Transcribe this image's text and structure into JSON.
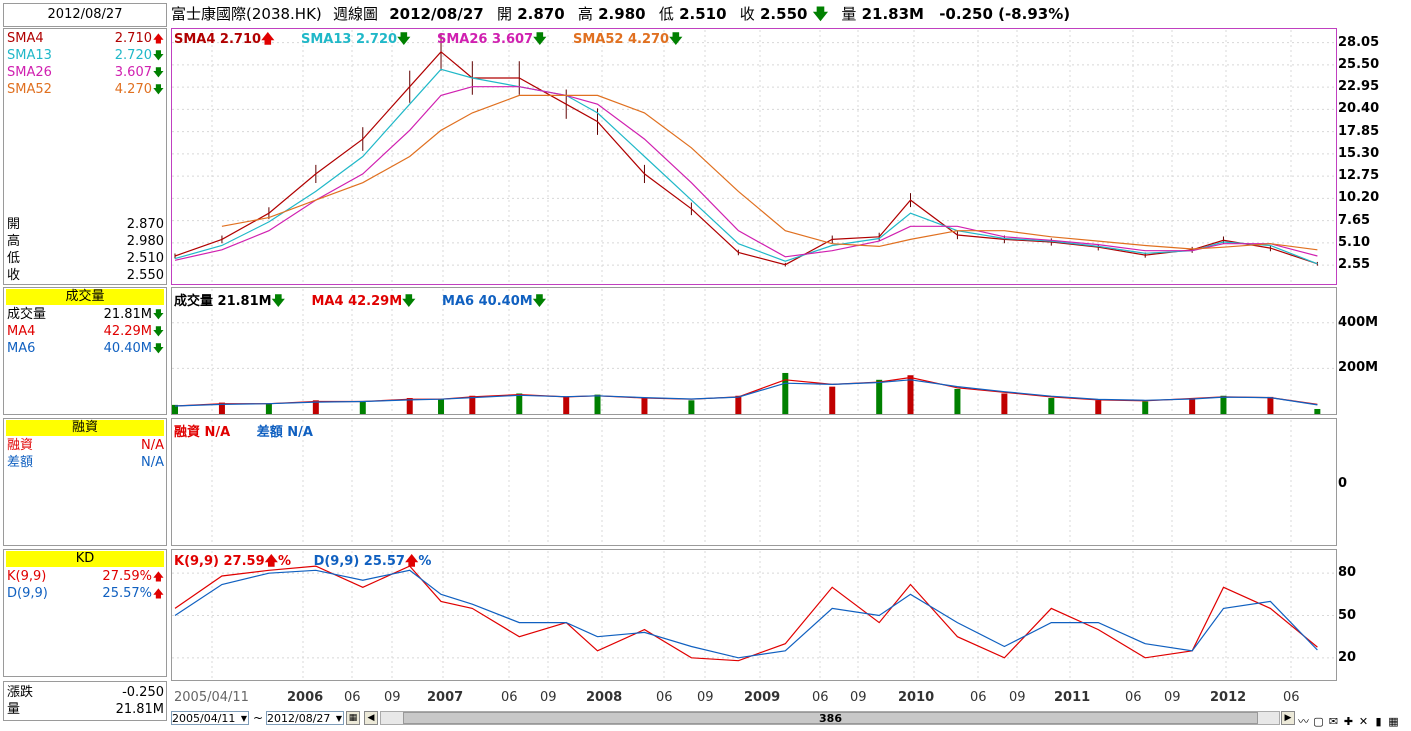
{
  "date_header": "2012/08/27",
  "title": {
    "stock": "富士康國際(2038.HK)",
    "period": "週線圖",
    "date": "2012/08/27",
    "open_label": "開",
    "open": "2.870",
    "high_label": "高",
    "high": "2.980",
    "low_label": "低",
    "low": "2.510",
    "close_label": "收",
    "close": "2.550",
    "vol_label": "量",
    "vol": "21.83M",
    "change": "-0.250 (-8.93%)"
  },
  "sma": [
    {
      "label": "SMA4",
      "value": "2.710",
      "dir": "up",
      "color": "#b00000"
    },
    {
      "label": "SMA13",
      "value": "2.720",
      "dir": "down",
      "color": "#20b8c8"
    },
    {
      "label": "SMA26",
      "value": "3.607",
      "dir": "down",
      "color": "#d020b0"
    },
    {
      "label": "SMA52",
      "value": "4.270",
      "dir": "down",
      "color": "#e07020"
    }
  ],
  "ohlc": [
    {
      "label": "開",
      "value": "2.870"
    },
    {
      "label": "高",
      "value": "2.980"
    },
    {
      "label": "低",
      "value": "2.510"
    },
    {
      "label": "收",
      "value": "2.550"
    }
  ],
  "volume": {
    "header": "成交量",
    "items": [
      {
        "label": "成交量",
        "value": "21.81M",
        "dir": "down",
        "color": "#000000"
      },
      {
        "label": "MA4",
        "value": "42.29M",
        "dir": "down",
        "color": "#e00000"
      },
      {
        "label": "MA6",
        "value": "40.40M",
        "dir": "down",
        "color": "#1060c0"
      }
    ]
  },
  "margin": {
    "header": "融資",
    "items": [
      {
        "label": "融資",
        "value": "N/A",
        "color": "#e00000"
      },
      {
        "label": "差額",
        "value": "N/A",
        "color": "#1060c0"
      }
    ]
  },
  "kd": {
    "header": "KD",
    "items": [
      {
        "label": "K(9,9)",
        "value": "27.59%",
        "dir": "up",
        "color": "#e00000"
      },
      {
        "label": "D(9,9)",
        "value": "25.57%",
        "dir": "up",
        "color": "#1060c0"
      }
    ],
    "legend_k": "K(9,9) 27.59",
    "legend_d": "D(9,9) 25.57"
  },
  "bottom": {
    "change_label": "漲跌",
    "change": "-0.250",
    "vol_label": "量",
    "vol": "21.81M"
  },
  "price_legend": [
    "SMA4 2.710",
    "SMA13 2.720",
    "SMA26 3.607",
    "SMA52 4.270"
  ],
  "volume_legend": [
    "成交量 21.81M",
    "MA4 42.29M",
    "MA6 40.40M"
  ],
  "margin_legend": [
    "融資 N/A",
    "差額 N/A"
  ],
  "controls": {
    "from": "2005/04/11",
    "tilde": "~",
    "to": "2012/08/27",
    "scroll_value": "386"
  },
  "chart_data": [
    {
      "type": "line",
      "title": "富士康國際(2038.HK) 週線圖",
      "y_ticks": [
        "28.05",
        "25.50",
        "22.95",
        "20.40",
        "17.85",
        "15.30",
        "12.75",
        "10.20",
        "7.65",
        "5.10",
        "2.55"
      ],
      "ylim": [
        0.5,
        29.5
      ],
      "x_ticks": [
        "2005/04/11",
        "2006",
        "06",
        "09",
        "2007",
        "06",
        "09",
        "2008",
        "06",
        "09",
        "2009",
        "06",
        "09",
        "2010",
        "06",
        "09",
        "2011",
        "06",
        "09",
        "2012",
        "06"
      ],
      "x": [
        2005.3,
        2005.6,
        2005.9,
        2006.2,
        2006.5,
        2006.8,
        2007.0,
        2007.2,
        2007.5,
        2007.8,
        2008.0,
        2008.3,
        2008.6,
        2008.9,
        2009.2,
        2009.5,
        2009.8,
        2010.0,
        2010.3,
        2010.6,
        2010.9,
        2011.2,
        2011.5,
        2011.8,
        2012.0,
        2012.3,
        2012.6
      ],
      "series": [
        {
          "name": "SMA4",
          "values": [
            3.6,
            5.5,
            8.5,
            13,
            17,
            23,
            27,
            24,
            24,
            21,
            19,
            13,
            9,
            4,
            2.6,
            5.5,
            5.8,
            10,
            6,
            5.5,
            5.2,
            4.6,
            3.7,
            4.3,
            5.4,
            4.5,
            2.7
          ]
        },
        {
          "name": "SMA13",
          "values": [
            3.3,
            4.8,
            7.5,
            11,
            15,
            21,
            25,
            24,
            23,
            22,
            20,
            15,
            10,
            5,
            3,
            4.8,
            5.6,
            8.5,
            6.5,
            5.6,
            5.3,
            4.7,
            3.9,
            4.2,
            5.2,
            4.8,
            2.7
          ]
        },
        {
          "name": "SMA26",
          "values": [
            3.1,
            4.3,
            6.5,
            10,
            13,
            18,
            22,
            23,
            23,
            22,
            21,
            17,
            12,
            6.5,
            3.5,
            4.2,
            5.3,
            7,
            7,
            5.8,
            5.4,
            4.9,
            4.2,
            4.2,
            5,
            5,
            3.6
          ]
        },
        {
          "name": "SMA52",
          "values": [
            null,
            7,
            8,
            10,
            12,
            15,
            18,
            20,
            22,
            22,
            22,
            20,
            16,
            11,
            6.5,
            5,
            4.7,
            5.5,
            6.5,
            6.5,
            5.8,
            5.3,
            4.8,
            4.4,
            4.6,
            5,
            4.3
          ]
        }
      ]
    },
    {
      "type": "bar",
      "title": "成交量",
      "y_ticks": [
        "400M",
        "200M"
      ],
      "ylim": [
        0,
        500
      ],
      "x": [
        2005.3,
        2005.6,
        2005.9,
        2006.2,
        2006.5,
        2006.8,
        2007.0,
        2007.2,
        2007.5,
        2007.8,
        2008.0,
        2008.3,
        2008.6,
        2008.9,
        2009.2,
        2009.5,
        2009.8,
        2010.0,
        2010.3,
        2010.6,
        2010.9,
        2011.2,
        2011.5,
        2011.8,
        2012.0,
        2012.3,
        2012.6
      ],
      "series": [
        {
          "name": "成交量",
          "values": [
            40,
            50,
            45,
            60,
            55,
            70,
            65,
            80,
            90,
            75,
            85,
            70,
            60,
            80,
            180,
            120,
            150,
            170,
            110,
            90,
            70,
            60,
            55,
            70,
            80,
            75,
            22
          ]
        },
        {
          "name": "MA4",
          "values": [
            35,
            45,
            45,
            55,
            55,
            65,
            65,
            75,
            85,
            75,
            80,
            70,
            65,
            75,
            150,
            130,
            140,
            160,
            115,
            95,
            75,
            62,
            58,
            68,
            75,
            72,
            42
          ]
        },
        {
          "name": "MA6",
          "values": [
            35,
            42,
            45,
            52,
            55,
            62,
            65,
            72,
            82,
            76,
            80,
            72,
            66,
            74,
            135,
            130,
            138,
            150,
            120,
            98,
            78,
            64,
            60,
            66,
            74,
            72,
            40
          ]
        }
      ]
    },
    {
      "type": "line",
      "title": "KD",
      "y_ticks": [
        "80",
        "50",
        "20"
      ],
      "ylim": [
        5,
        95
      ],
      "x": [
        2005.3,
        2005.6,
        2005.9,
        2006.2,
        2006.5,
        2006.8,
        2007.0,
        2007.2,
        2007.5,
        2007.8,
        2008.0,
        2008.3,
        2008.6,
        2008.9,
        2009.2,
        2009.5,
        2009.8,
        2010.0,
        2010.3,
        2010.6,
        2010.9,
        2011.2,
        2011.5,
        2011.8,
        2012.0,
        2012.3,
        2012.6
      ],
      "series": [
        {
          "name": "K(9,9)",
          "values": [
            55,
            78,
            82,
            85,
            70,
            85,
            60,
            55,
            35,
            45,
            25,
            40,
            20,
            18,
            30,
            70,
            45,
            72,
            35,
            20,
            55,
            40,
            20,
            25,
            70,
            55,
            27.59
          ]
        },
        {
          "name": "D(9,9)",
          "values": [
            50,
            72,
            80,
            82,
            75,
            82,
            65,
            58,
            45,
            45,
            35,
            38,
            28,
            20,
            25,
            55,
            50,
            65,
            45,
            28,
            45,
            45,
            30,
            25,
            55,
            60,
            25.57
          ]
        }
      ]
    }
  ]
}
